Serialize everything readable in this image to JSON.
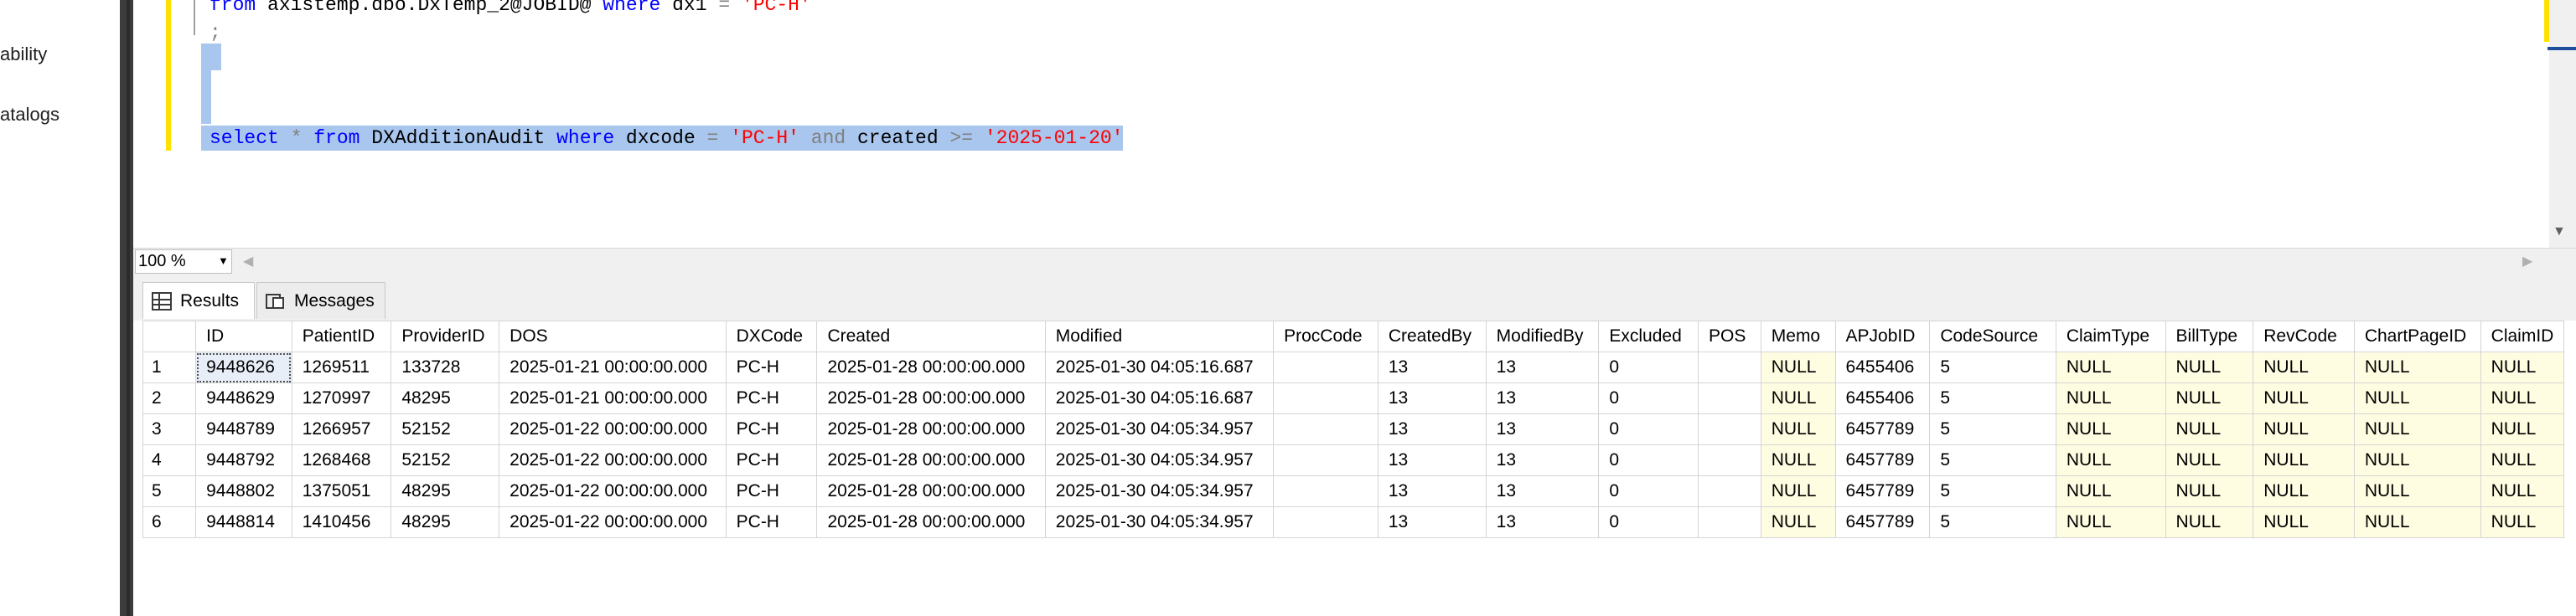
{
  "explorer": {
    "items": [
      "ability",
      "atalogs"
    ]
  },
  "editor": {
    "line1": {
      "kw_from": "from",
      "table": " axistemp.dbo.DxTemp_2@JOBID@ ",
      "kw_where": "where",
      "col": " dx1 ",
      "eq": "=",
      "str": " 'PC-H'"
    },
    "line2": ";",
    "query": {
      "select": "select",
      "star": " * ",
      "from": "from",
      "table": " DXAdditionAudit ",
      "where": "where",
      "col1": " dxcode ",
      "eq": "=",
      "val1": " 'PC-H' ",
      "and": "and",
      "col2": " created ",
      "gte": ">=",
      "val2": " '2025-01-20'"
    }
  },
  "zoom": {
    "value": "100 %"
  },
  "tabs": [
    {
      "label": "Results",
      "icon": "grid-icon",
      "active": true
    },
    {
      "label": "Messages",
      "icon": "messages-icon",
      "active": false
    }
  ],
  "results": {
    "columns": [
      "ID",
      "PatientID",
      "ProviderID",
      "DOS",
      "DXCode",
      "Created",
      "Modified",
      "ProcCode",
      "CreatedBy",
      "ModifiedBy",
      "Excluded",
      "POS",
      "Memo",
      "APJobID",
      "CodeSource",
      "ClaimType",
      "BillType",
      "RevCode",
      "ChartPageID",
      "ClaimID"
    ],
    "rows": [
      [
        "1",
        "9448626",
        "1269511",
        "133728",
        "2025-01-21 00:00:00.000",
        "PC-H",
        "2025-01-28 00:00:00.000",
        "2025-01-30 04:05:16.687",
        "",
        "13",
        "13",
        "0",
        "",
        "NULL",
        "6455406",
        "5",
        "NULL",
        "NULL",
        "NULL",
        "NULL",
        "NULL"
      ],
      [
        "2",
        "9448629",
        "1270997",
        "48295",
        "2025-01-21 00:00:00.000",
        "PC-H",
        "2025-01-28 00:00:00.000",
        "2025-01-30 04:05:16.687",
        "",
        "13",
        "13",
        "0",
        "",
        "NULL",
        "6455406",
        "5",
        "NULL",
        "NULL",
        "NULL",
        "NULL",
        "NULL"
      ],
      [
        "3",
        "9448789",
        "1266957",
        "52152",
        "2025-01-22 00:00:00.000",
        "PC-H",
        "2025-01-28 00:00:00.000",
        "2025-01-30 04:05:34.957",
        "",
        "13",
        "13",
        "0",
        "",
        "NULL",
        "6457789",
        "5",
        "NULL",
        "NULL",
        "NULL",
        "NULL",
        "NULL"
      ],
      [
        "4",
        "9448792",
        "1268468",
        "52152",
        "2025-01-22 00:00:00.000",
        "PC-H",
        "2025-01-28 00:00:00.000",
        "2025-01-30 04:05:34.957",
        "",
        "13",
        "13",
        "0",
        "",
        "NULL",
        "6457789",
        "5",
        "NULL",
        "NULL",
        "NULL",
        "NULL",
        "NULL"
      ],
      [
        "5",
        "9448802",
        "1375051",
        "48295",
        "2025-01-22 00:00:00.000",
        "PC-H",
        "2025-01-28 00:00:00.000",
        "2025-01-30 04:05:34.957",
        "",
        "13",
        "13",
        "0",
        "",
        "NULL",
        "6457789",
        "5",
        "NULL",
        "NULL",
        "NULL",
        "NULL",
        "NULL"
      ],
      [
        "6",
        "9448814",
        "1410456",
        "48295",
        "2025-01-22 00:00:00.000",
        "PC-H",
        "2025-01-28 00:00:00.000",
        "2025-01-30 04:05:34.957",
        "",
        "13",
        "13",
        "0",
        "",
        "NULL",
        "6457789",
        "5",
        "NULL",
        "NULL",
        "NULL",
        "NULL",
        "NULL"
      ]
    ]
  },
  "colors": {
    "keyword": "#0000ff",
    "string": "#ff0000",
    "operator": "#808080",
    "selection": "#a8c6ee",
    "null_cell": "#fffde1",
    "change_bar": "#ffe100"
  }
}
